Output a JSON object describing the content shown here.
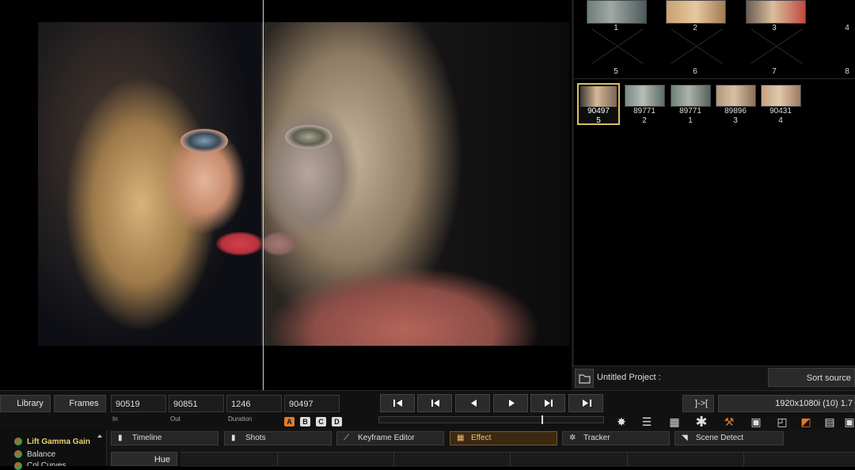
{
  "browser": {
    "top_row": [
      {
        "label": "1"
      },
      {
        "label": "2"
      },
      {
        "label": "3"
      }
    ],
    "empty_row": [
      {
        "label": "5"
      },
      {
        "label": "6"
      },
      {
        "label": "7"
      },
      {
        "label": "8"
      }
    ],
    "shots": [
      {
        "frame": "90497",
        "index": "5"
      },
      {
        "frame": "89771",
        "index": "2"
      },
      {
        "frame": "89771",
        "index": "1"
      },
      {
        "frame": "89896",
        "index": "3"
      },
      {
        "frame": "90431",
        "index": "4"
      }
    ],
    "project_name": "Untitled Project :",
    "sort_label": "Sort source"
  },
  "controls": {
    "library_label": "Library",
    "frames_label": "Frames",
    "in_value": "90519",
    "in_label": "In",
    "out_value": "90851",
    "out_label": "Out",
    "duration_value": "1246",
    "duration_label": "Duration",
    "current_value": "90497",
    "marks": [
      "A",
      "B",
      "C",
      "D"
    ],
    "loop_label": "]->[",
    "resolution_label": "1920x1080i (10) 1.7"
  },
  "tabs": {
    "timeline": "Timeline",
    "shots": "Shots",
    "keyframe": "Keyframe Editor",
    "effect": "Effect",
    "tracker": "Tracker",
    "scene_detect": "Scene Detect"
  },
  "effects": {
    "items": [
      "Lift Gamma Gain",
      "Balance",
      "Col Curves"
    ],
    "hue_label": "Hue"
  },
  "colors": {
    "accent": "#f0c070",
    "active_item": "#e8d070",
    "selected_border": "#d8c060"
  }
}
